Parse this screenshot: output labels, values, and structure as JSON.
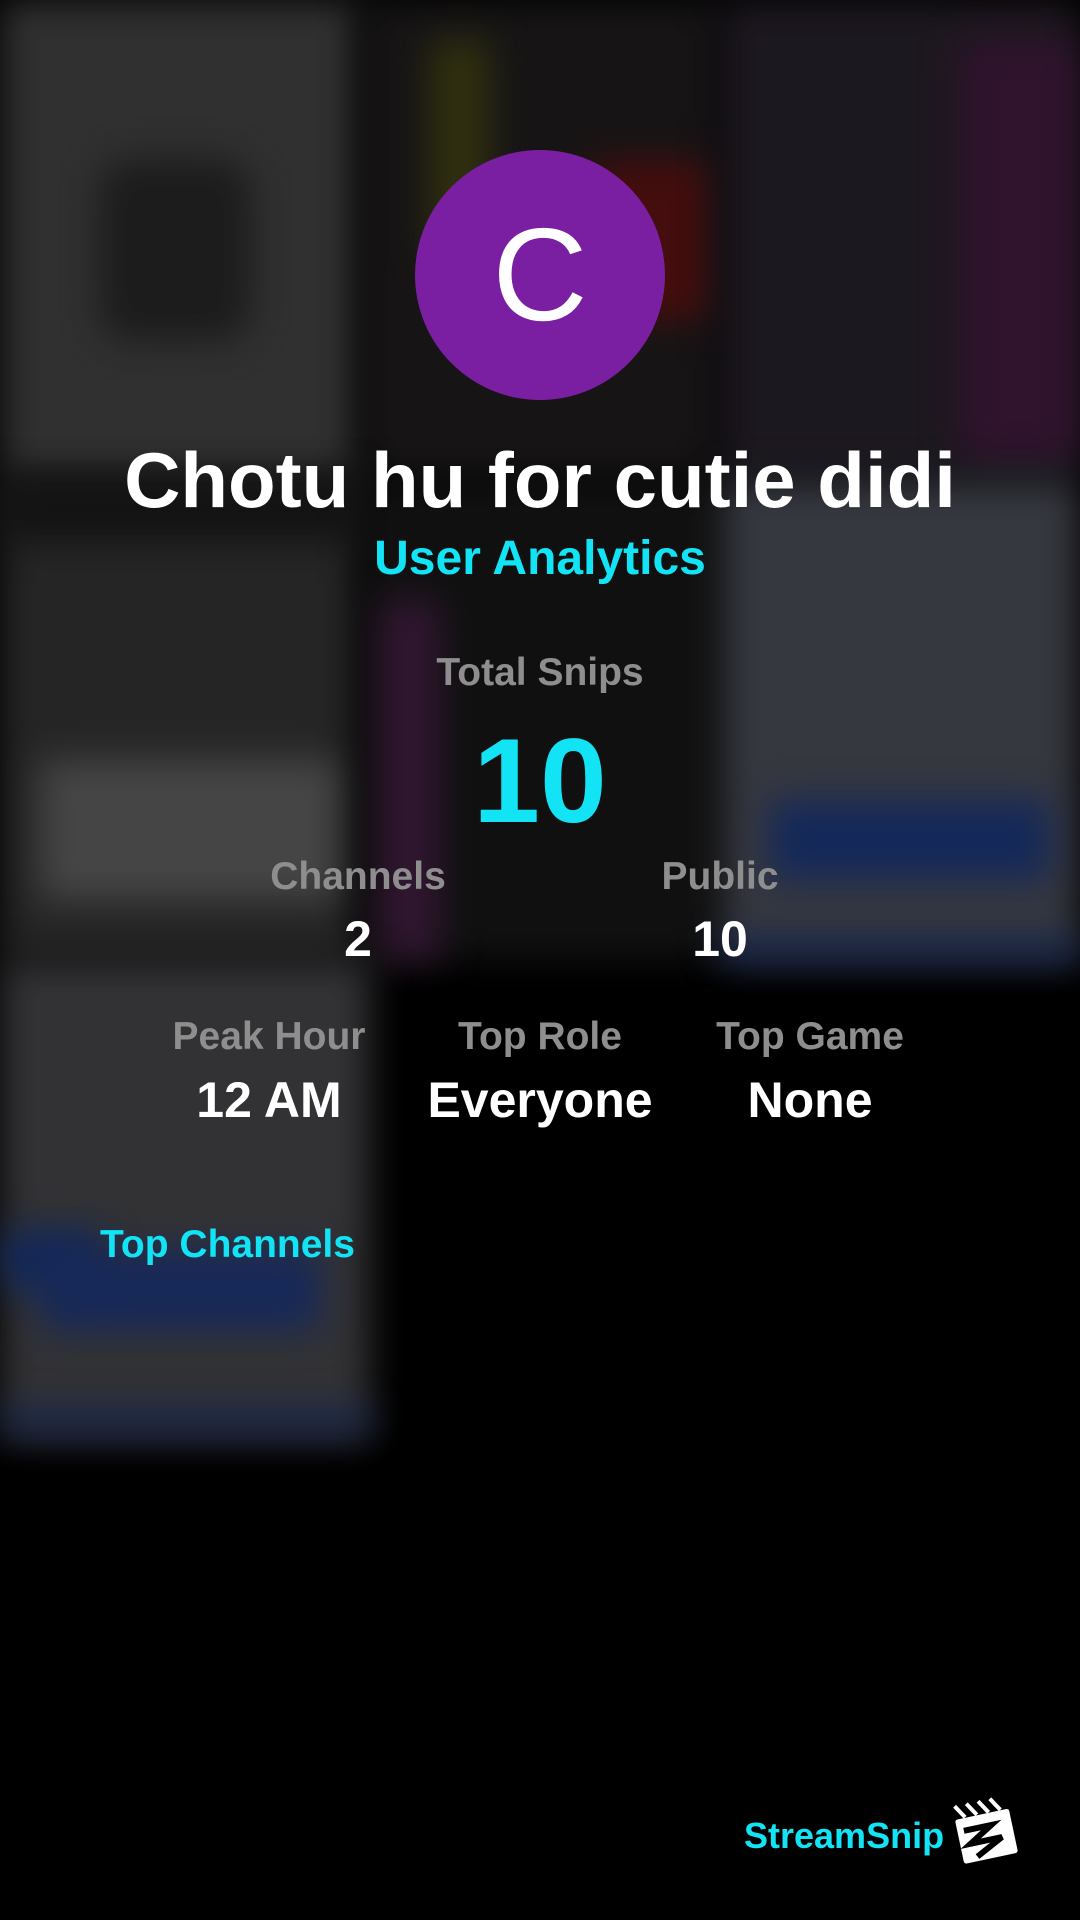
{
  "user": {
    "avatar_letter": "C",
    "name": "Chotu hu for cutie didi",
    "subtitle": "User Analytics"
  },
  "stats": {
    "total_snips": {
      "label": "Total Snips",
      "value": "10"
    },
    "channels": {
      "label": "Channels",
      "value": "2"
    },
    "public": {
      "label": "Public",
      "value": "10"
    },
    "peak_hour": {
      "label": "Peak Hour",
      "value": "12 AM"
    },
    "top_role": {
      "label": "Top Role",
      "value": "Everyone"
    },
    "top_game": {
      "label": "Top Game",
      "value": "None"
    }
  },
  "sections": {
    "top_channels": "Top Channels"
  },
  "branding": {
    "name": "StreamSnip",
    "logo_icon": "clapperboard-icon"
  },
  "colors": {
    "accent": "#12e3f5",
    "avatar": "#7b1fa2",
    "label": "#8e8e8e",
    "background": "#000000"
  }
}
